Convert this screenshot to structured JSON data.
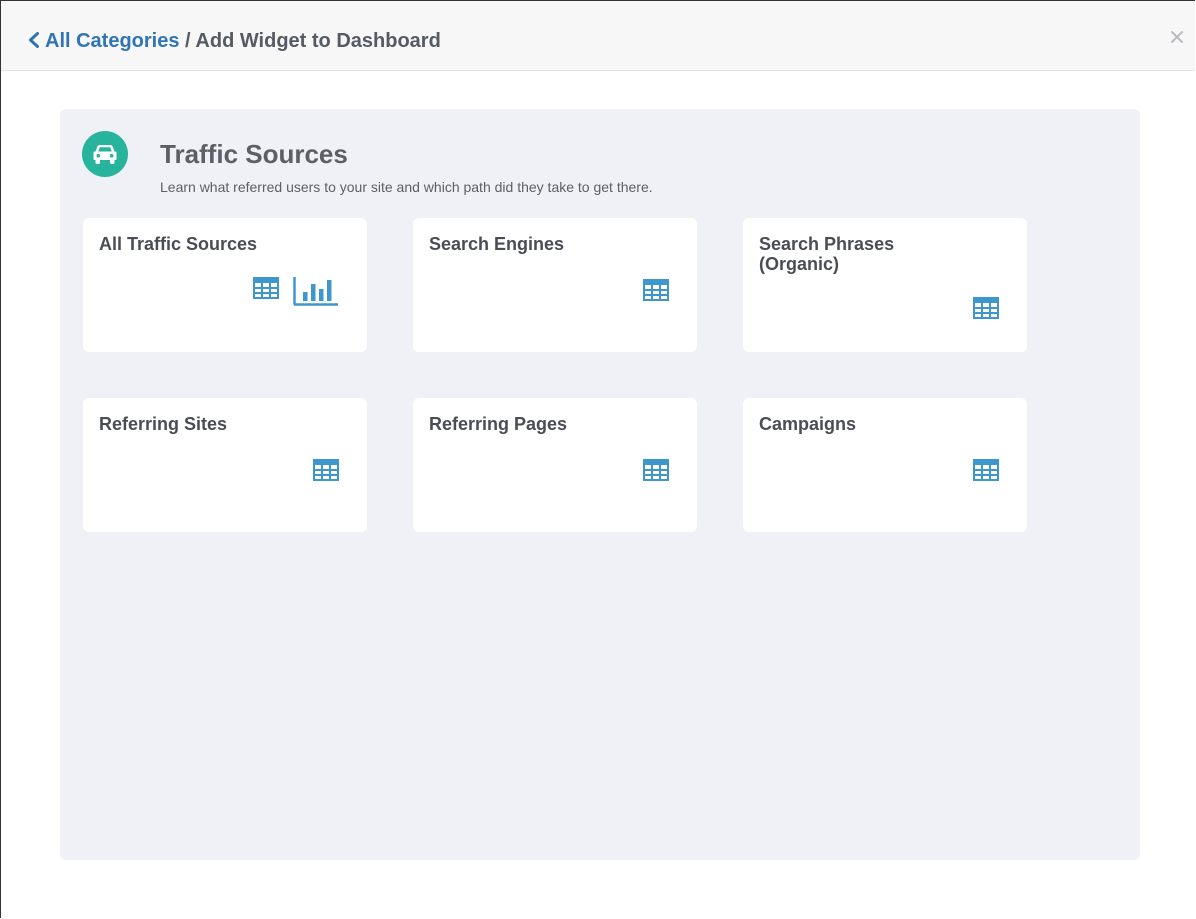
{
  "header": {
    "back_label": "All Categories",
    "separator": " / ",
    "title": "Add Widget to Dashboard",
    "close_glyph": "×"
  },
  "category": {
    "icon": "car-icon",
    "icon_color": "#27b39c",
    "title": "Traffic Sources",
    "description": "Learn what referred users to your site and which path did they take to get there."
  },
  "widgets": [
    {
      "title": "All Traffic Sources",
      "views": [
        "table-icon",
        "bar-chart-icon"
      ]
    },
    {
      "title": "Search Engines",
      "views": [
        "table-icon"
      ]
    },
    {
      "title": "Search Phrases (Organic)",
      "views": [
        "table-icon"
      ]
    },
    {
      "title": "Referring Sites",
      "views": [
        "table-icon"
      ]
    },
    {
      "title": "Referring Pages",
      "views": [
        "table-icon"
      ]
    },
    {
      "title": "Campaigns",
      "views": [
        "table-icon"
      ]
    }
  ],
  "colors": {
    "link": "#2f74b5",
    "icon_blue": "#3d97cc",
    "panel_bg": "#eff1f6"
  }
}
